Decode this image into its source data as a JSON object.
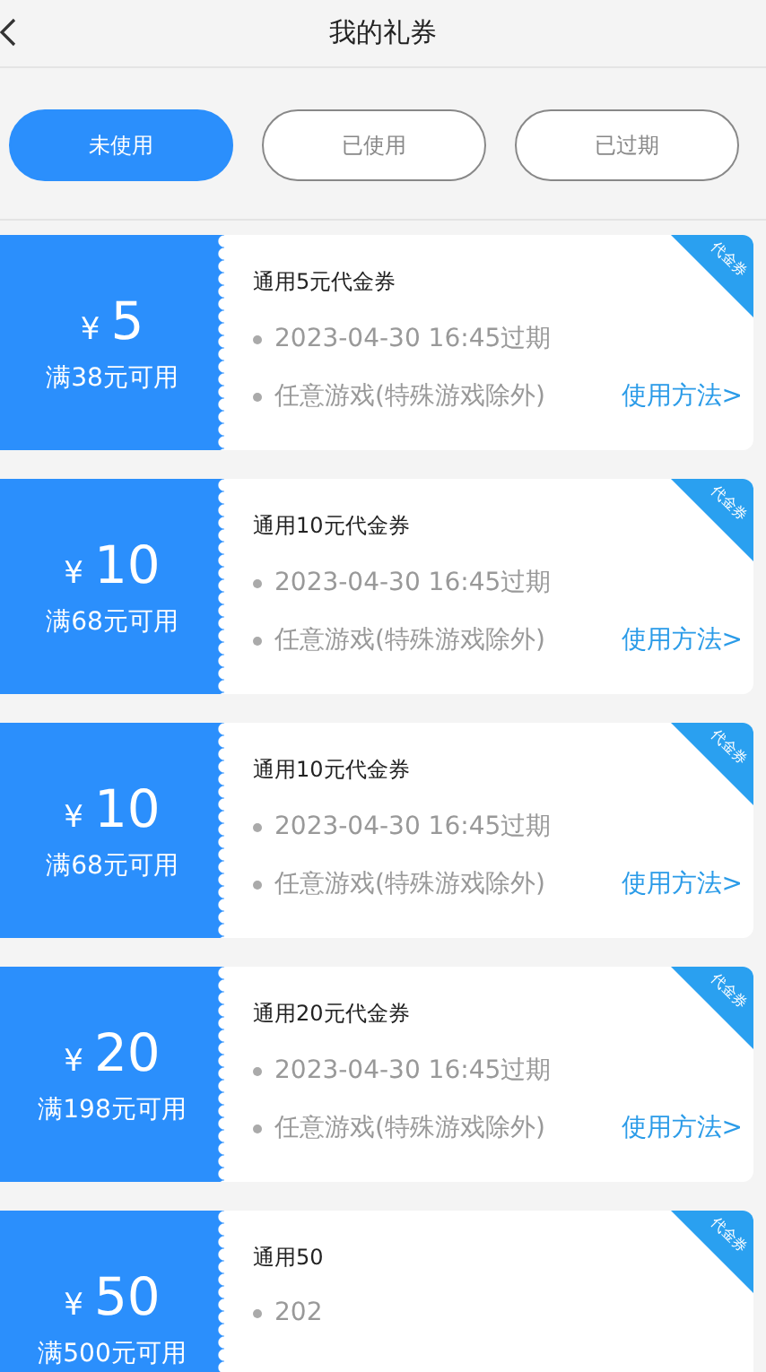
{
  "header": {
    "title": "我的礼券"
  },
  "tabs": [
    {
      "label": "未使用",
      "selected": true
    },
    {
      "label": "已使用",
      "selected": false
    },
    {
      "label": "已过期",
      "selected": false
    }
  ],
  "coupons": [
    {
      "currency": "¥",
      "amount": "5",
      "condition": "满38元可用",
      "title": "通用5元代金券",
      "expiry": "2023-04-30 16:45过期",
      "scope": "任意游戏(特殊游戏除外)",
      "link": "使用方法>",
      "ribbon": "代金券"
    },
    {
      "currency": "¥",
      "amount": "10",
      "condition": "满68元可用",
      "title": "通用10元代金券",
      "expiry": "2023-04-30 16:45过期",
      "scope": "任意游戏(特殊游戏除外)",
      "link": "使用方法>",
      "ribbon": "代金券"
    },
    {
      "currency": "¥",
      "amount": "10",
      "condition": "满68元可用",
      "title": "通用10元代金券",
      "expiry": "2023-04-30 16:45过期",
      "scope": "任意游戏(特殊游戏除外)",
      "link": "使用方法>",
      "ribbon": "代金券"
    },
    {
      "currency": "¥",
      "amount": "20",
      "condition": "满198元可用",
      "title": "通用20元代金券",
      "expiry": "2023-04-30 16:45过期",
      "scope": "任意游戏(特殊游戏除外)",
      "link": "使用方法>",
      "ribbon": "代金券"
    },
    {
      "currency": "¥",
      "amount": "50",
      "condition": "满500元可用",
      "title": "通用50",
      "expiry": "202",
      "ribbon": "代金券"
    }
  ]
}
